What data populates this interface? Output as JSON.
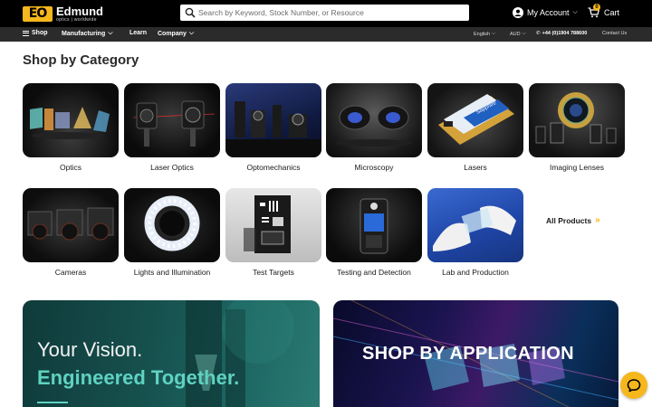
{
  "header": {
    "logo": {
      "mark": "EO",
      "name": "Edmund",
      "tagline": "optics | worldwide"
    },
    "search": {
      "placeholder": "Search by Keyword, Stock Number, or Resource",
      "value": ""
    },
    "account_label": "My Account",
    "cart": {
      "label": "Cart",
      "count": "0"
    }
  },
  "nav": {
    "shop": "Shop",
    "manufacturing": "Manufacturing",
    "learn": "Learn",
    "company": "Company",
    "language": "English",
    "currency": "AUD",
    "phone": "+44 (0)1904 788600",
    "contact": "Contact Us"
  },
  "section_title": "Shop by Category",
  "categories": [
    {
      "label": "Optics",
      "icon": "optics-image"
    },
    {
      "label": "Laser Optics",
      "icon": "laser-optics-image"
    },
    {
      "label": "Optomechanics",
      "icon": "optomechanics-image"
    },
    {
      "label": "Microscopy",
      "icon": "microscopy-image"
    },
    {
      "label": "Lasers",
      "icon": "lasers-image"
    },
    {
      "label": "Imaging Lenses",
      "icon": "imaging-lenses-image"
    },
    {
      "label": "Cameras",
      "icon": "cameras-image"
    },
    {
      "label": "Lights and Illumination",
      "icon": "lights-image"
    },
    {
      "label": "Test Targets",
      "icon": "test-targets-image"
    },
    {
      "label": "Testing and Detection",
      "icon": "testing-image"
    },
    {
      "label": "Lab and Production",
      "icon": "lab-image"
    }
  ],
  "all_products": "All Products",
  "banners": {
    "left": {
      "line1": "Your Vision.",
      "line2": "Engineered Together."
    },
    "right": {
      "title": "SHOP BY APPLICATION"
    }
  },
  "colors": {
    "brand_yellow": "#f6b71c",
    "header_bg": "#000000",
    "nav_bg": "#2b2b2b",
    "teal": "#5fd2c0"
  }
}
